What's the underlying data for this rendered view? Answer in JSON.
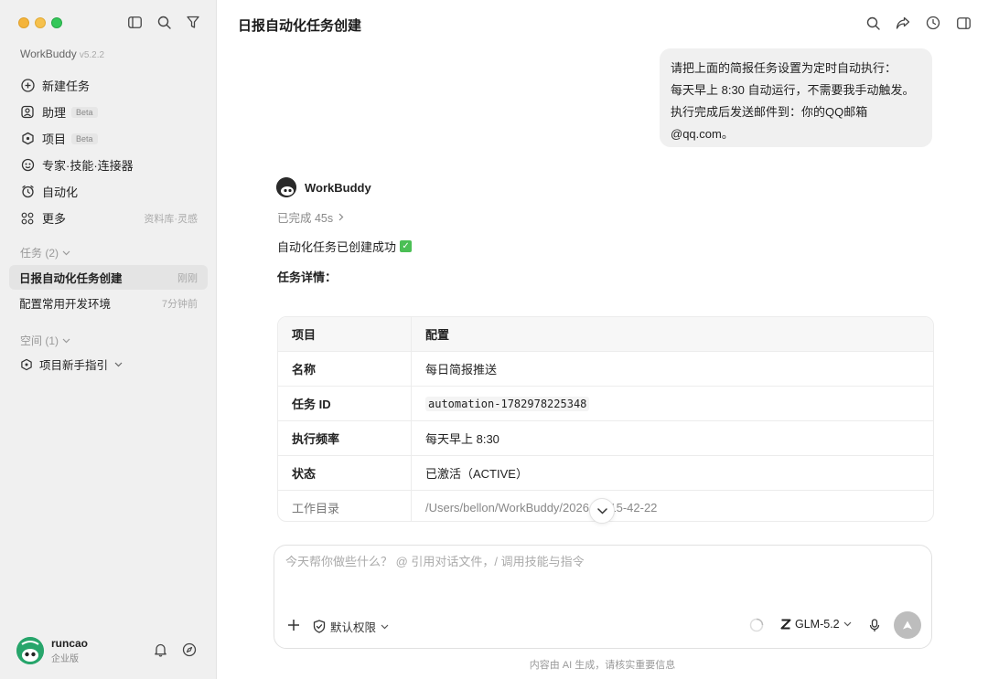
{
  "sidebar": {
    "app_name": "WorkBuddy",
    "version": "v5.2.2",
    "nav": [
      {
        "label": "新建任务",
        "icon": "plus-circle-icon"
      },
      {
        "label": "助理",
        "icon": "assistant-icon",
        "badge": "Beta"
      },
      {
        "label": "项目",
        "icon": "project-icon",
        "badge": "Beta"
      },
      {
        "label": "专家·技能·连接器",
        "icon": "expert-icon"
      },
      {
        "label": "自动化",
        "icon": "alarm-icon"
      },
      {
        "label": "更多",
        "icon": "grid-icon",
        "hint": "资料库·灵感"
      }
    ],
    "tasks_title": "任务 (2)",
    "tasks": [
      {
        "label": "日报自动化任务创建",
        "time": "刚刚",
        "active": true
      },
      {
        "label": "配置常用开发环境",
        "time": "7分钟前",
        "active": false
      }
    ],
    "spaces_title": "空间 (1)",
    "space_item": "项目新手指引",
    "user": {
      "name": "runcao",
      "org": "企业版"
    }
  },
  "main": {
    "title": "日报自动化任务创建",
    "user_message": [
      "请把上面的简报任务设置为定时自动执行：",
      "每天早上 8:30 自动运行，不需要我手动触发。",
      "执行完成后发送邮件到：你的QQ邮箱@qq.com。"
    ],
    "agent_name": "WorkBuddy",
    "agent_status": "已完成 45s",
    "reply_success": "自动化任务已创建成功",
    "details_heading": "任务详情：",
    "table": {
      "headers": [
        "项目",
        "配置"
      ],
      "rows": [
        {
          "key": "名称",
          "value": "每日简报推送"
        },
        {
          "key": "任务 ID",
          "value": "automation-1782978225348"
        },
        {
          "key": "执行频率",
          "value": "每天早上 8:30"
        },
        {
          "key": "状态",
          "value": "已激活（ACTIVE）"
        },
        {
          "key": "工作目录",
          "value": "/Users/bellon/WorkBuddy/2026 02-15-42-22"
        }
      ]
    },
    "composer": {
      "placeholder": "今天帮你做些什么？ @ 引用对话文件，/ 调用技能与指令",
      "permission": "默认权限",
      "model": "GLM-5.2"
    },
    "disclaimer": "内容由 AI 生成，请核实重要信息"
  },
  "colors": {
    "sidebar_bg": "#f0f0f0",
    "bubble_bg": "#f0f0f0",
    "success_green": "#4bbf55",
    "avatar_green": "#27a56b",
    "send_disabled": "#bdbdbd"
  }
}
